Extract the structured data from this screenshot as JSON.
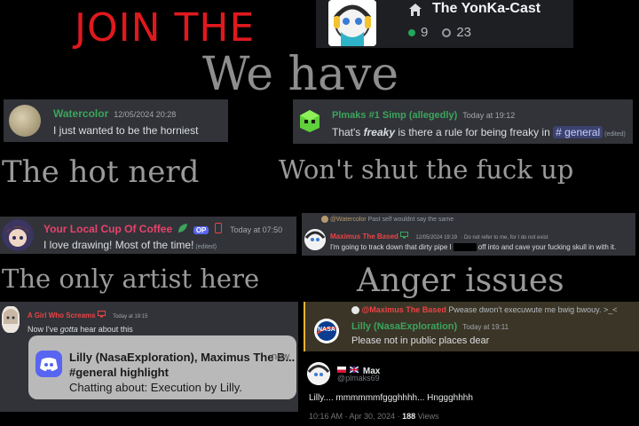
{
  "captions": {
    "join": "JOIN THE",
    "we_have": "We have",
    "hot_nerd": "The hot nerd",
    "wont_shut_up": "Won't shut the fuck up",
    "only_artist": "The only artist here",
    "anger": "Anger issues"
  },
  "server": {
    "name": "The YonKa-Cast",
    "online": "9",
    "members": "23",
    "icon": "home-icon"
  },
  "msg_watercolor": {
    "user": "Watercolor",
    "time": "12/05/2024 20:28",
    "text": "I just wanted to be the horniest",
    "color": "#3ba55d"
  },
  "msg_plmaks": {
    "user": "Plmaks #1 Simp (allegedly)",
    "time": "Today at 19:12",
    "text_pre": "That's ",
    "text_bold": "freaky",
    "text_mid": " is there a rule for being freaky in ",
    "channel": "# general",
    "edited": "(edited)",
    "color": "#3ba55d"
  },
  "msg_coffee": {
    "user": "Your Local Cup Of Coffee",
    "badge": "OP",
    "time": "Today at 07:50",
    "text": "I love drawing! Most of the time!",
    "edited": "(edited)",
    "color": "#e8436c"
  },
  "msg_maximus": {
    "reply_user": "@Watercolor",
    "reply_text": "Past self wouldnt say the same",
    "user": "Maximus The Based",
    "time": "12/05/2024 19:19",
    "note": "· Do not refer to me, for I do not exist",
    "text_pre": "I'm going to track down that dirty pipe I",
    "text_post": "off into and cave your fucking skull in with it.",
    "color": "#ed4245"
  },
  "msg_girl": {
    "user": "A Girl Who Screams",
    "time": "Today at 19:15",
    "text_pre": "Now I've ",
    "text_italic": "gotta",
    "text_post": " hear about this",
    "color": "#ed4245"
  },
  "notification": {
    "title": "Lilly (NasaExploration), Maximus The B...",
    "now": "now",
    "line2": "#general highlight",
    "line3": "Chatting about: Execution by Lilly."
  },
  "msg_lilly": {
    "reply_user": "@Maximus The Based",
    "reply_text": "Pwease dwon't execuwute me bwig bwouy. >_<",
    "user": "Lilly (NasaExploration)",
    "time": "Today at 19:11",
    "text": "Please not in public places dear",
    "avatar_text": "NASA",
    "color": "#3ba55d"
  },
  "tweet": {
    "name": "Max",
    "handle": "@plmaks69",
    "text": "Lilly.... mmmmmmfggghhhh... Hnggghhhh",
    "date": "10:16 AM · Apr 30, 2024 · ",
    "views": "188",
    "views_label": " Views"
  }
}
